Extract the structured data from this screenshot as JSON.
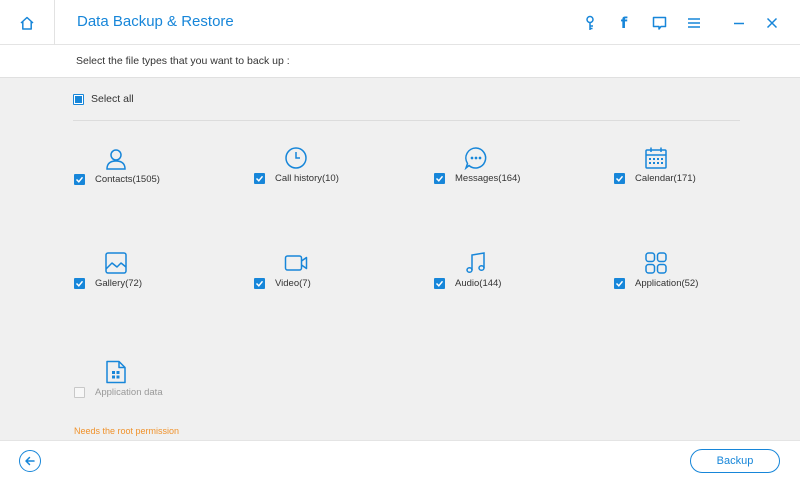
{
  "header": {
    "title": "Data Backup & Restore",
    "facebook_glyph": "f",
    "icons": [
      "home-icon",
      "key-icon",
      "facebook-icon",
      "feedback-icon",
      "menu-icon",
      "minimize-icon",
      "close-icon"
    ]
  },
  "subheader": {
    "instruction": "Select the file types that you want to back up :"
  },
  "select_all": {
    "label": "Select all",
    "state": "partial"
  },
  "items": [
    {
      "label": "Contacts(1505)",
      "icon": "contacts-icon",
      "checked": true
    },
    {
      "label": "Call history(10)",
      "icon": "call-history-icon",
      "checked": true
    },
    {
      "label": "Messages(164)",
      "icon": "messages-icon",
      "checked": true
    },
    {
      "label": "Calendar(171)",
      "icon": "calendar-icon",
      "checked": true
    },
    {
      "label": "Gallery(72)",
      "icon": "gallery-icon",
      "checked": true
    },
    {
      "label": "Video(7)",
      "icon": "video-icon",
      "checked": true
    },
    {
      "label": "Audio(144)",
      "icon": "audio-icon",
      "checked": true
    },
    {
      "label": "Application(52)",
      "icon": "application-icon",
      "checked": true
    },
    {
      "label": "Application data",
      "icon": "application-data-icon",
      "checked": false,
      "disabled": true
    }
  ],
  "root_note": "Needs the root permission",
  "footer": {
    "backup_label": "Backup"
  },
  "colors": {
    "accent": "#1786d9",
    "warning": "#f0922b",
    "background": "#f0f0f0"
  }
}
